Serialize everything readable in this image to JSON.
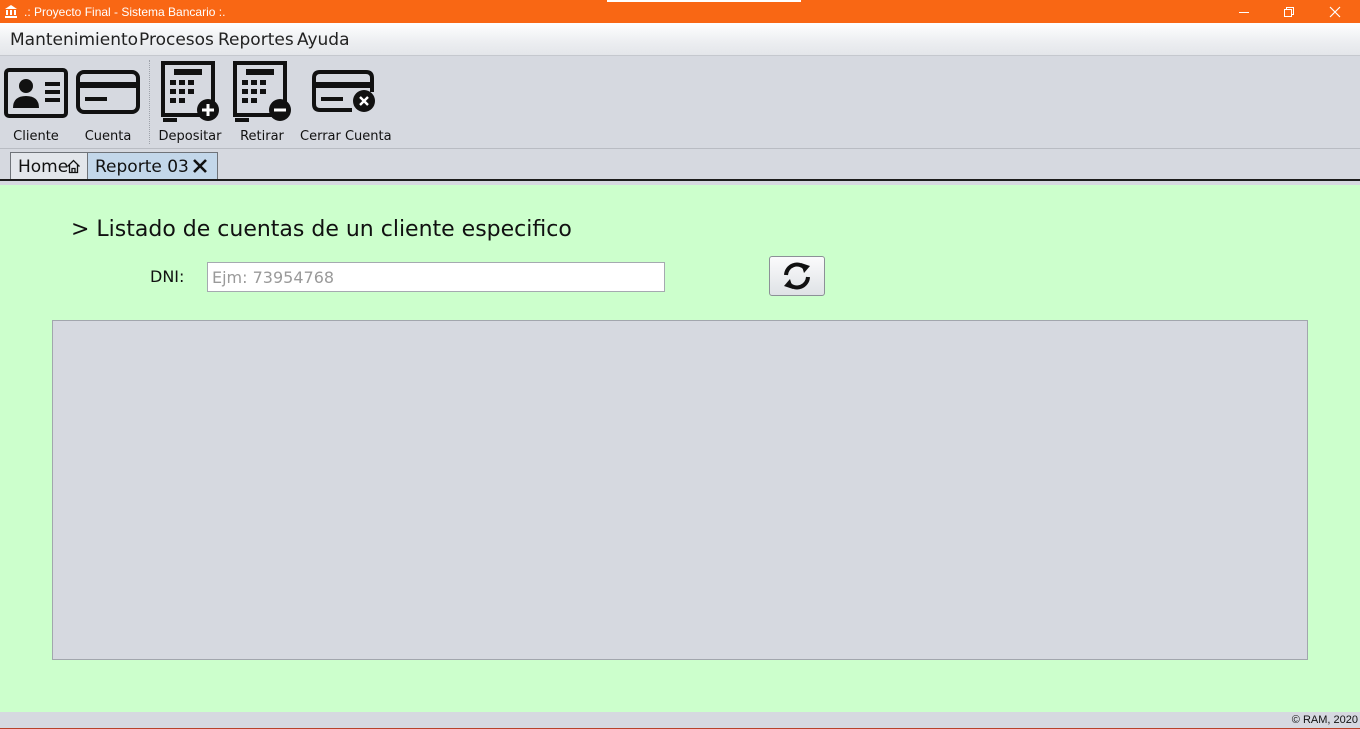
{
  "window": {
    "title": ".: Proyecto Final - Sistema Bancario :.",
    "icon": "bank-icon",
    "controls": {
      "minimize": "minimize-icon",
      "maximize": "restore-icon",
      "close": "close-icon"
    },
    "accent_color": "#f96714"
  },
  "menu": {
    "items": [
      {
        "label": "Mantenimiento"
      },
      {
        "label": "Procesos"
      },
      {
        "label": "Reportes"
      },
      {
        "label": "Ayuda"
      }
    ]
  },
  "toolbar": {
    "buttons": [
      {
        "label": "Cliente",
        "icon": "id-card-icon"
      },
      {
        "label": "Cuenta",
        "icon": "credit-card-icon"
      },
      {
        "label": "Depositar",
        "icon": "calculator-plus-icon"
      },
      {
        "label": "Retirar",
        "icon": "calculator-minus-icon"
      },
      {
        "label": "Cerrar Cuenta",
        "icon": "card-remove-icon"
      }
    ]
  },
  "tabs": [
    {
      "label": "Home",
      "icon": "home-icon",
      "active": false
    },
    {
      "label": "Reporte 03",
      "icon": "close-tab-icon",
      "active": true
    }
  ],
  "report": {
    "heading": "> Listado de cuentas de un cliente especifico",
    "dni_label": "DNI:",
    "dni_value": "",
    "dni_placeholder": "Ejm: 73954768",
    "refresh_icon": "refresh-icon",
    "background_color": "#ccffcc"
  },
  "status": {
    "copyright": "© RAM, 2020"
  }
}
